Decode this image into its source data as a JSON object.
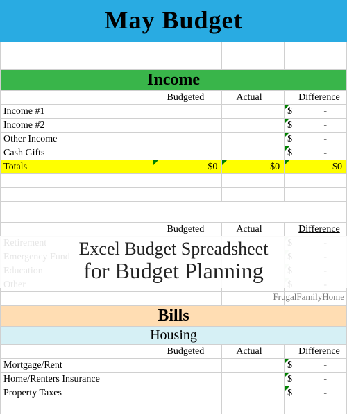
{
  "title": "May Budget",
  "columns": {
    "budgeted": "Budgeted",
    "actual": "Actual",
    "difference": "Difference"
  },
  "income": {
    "header": "Income",
    "rows": [
      {
        "label": "Income #1",
        "diff": {
          "sym": "$",
          "val": "-"
        }
      },
      {
        "label": "Income #2",
        "diff": {
          "sym": "$",
          "val": "-"
        }
      },
      {
        "label": "Other Income",
        "diff": {
          "sym": "$",
          "val": "-"
        }
      },
      {
        "label": "Cash Gifts",
        "diff": {
          "sym": "$",
          "val": "-"
        }
      }
    ],
    "totals": {
      "label": "Totals",
      "budgeted": "$0",
      "actual": "$0",
      "difference": "$0"
    }
  },
  "savings_faded": {
    "rows": [
      {
        "label": "Retirement"
      },
      {
        "label": "Emergency Fund"
      },
      {
        "label": "Education"
      },
      {
        "label": "Other"
      }
    ]
  },
  "overlay": {
    "line1": "Excel Budget Spreadsheet",
    "line2": "for Budget Planning"
  },
  "watermark": "FrugalFamilyHome",
  "bills": {
    "header": "Bills",
    "housing": {
      "header": "Housing",
      "rows": [
        {
          "label": "Mortgage/Rent",
          "diff": {
            "sym": "$",
            "val": "-"
          }
        },
        {
          "label": "Home/Renters Insurance",
          "diff": {
            "sym": "$",
            "val": "-"
          }
        },
        {
          "label": "Property Taxes",
          "diff": {
            "sym": "$",
            "val": "-"
          }
        }
      ]
    }
  }
}
